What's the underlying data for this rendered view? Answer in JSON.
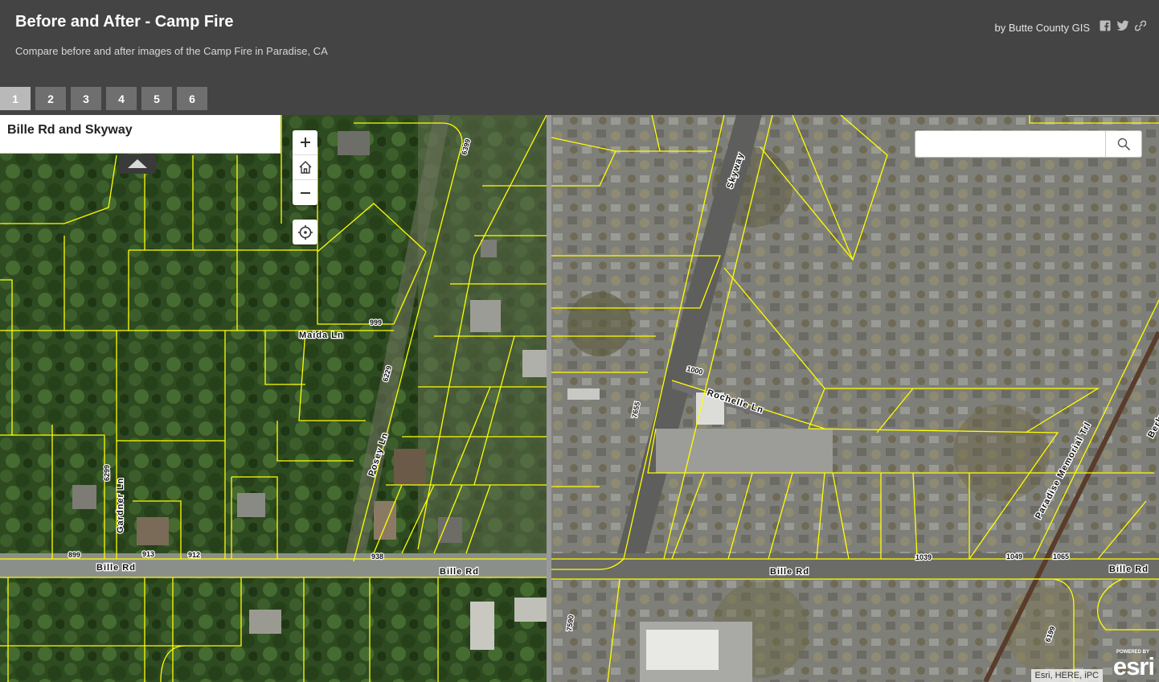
{
  "header": {
    "title": "Before and After - Camp Fire",
    "subtitle": "Compare before and after images of the Camp Fire in Paradise, CA",
    "byline": "by Butte County GIS",
    "share_icons": [
      "facebook-icon",
      "twitter-icon",
      "link-icon"
    ]
  },
  "tabs": [
    {
      "label": "1",
      "active": true
    },
    {
      "label": "2",
      "active": false
    },
    {
      "label": "3",
      "active": false
    },
    {
      "label": "4",
      "active": false
    },
    {
      "label": "5",
      "active": false
    },
    {
      "label": "6",
      "active": false
    }
  ],
  "panel": {
    "title": "Bille Rd and Skyway"
  },
  "map_controls": {
    "zoom_in": "+",
    "zoom_out": "−",
    "icons": [
      "plus-icon",
      "home-icon",
      "minus-icon",
      "locate-icon"
    ]
  },
  "search": {
    "placeholder": "",
    "value": ""
  },
  "map_before": {
    "labels": {
      "maida": "Maida Ln",
      "posey": "Posey Ln",
      "gardner": "Gardner Ln",
      "bille_1": "Bille Rd",
      "bille_2": "Bille Rd",
      "n6399": "6399",
      "n999": "999",
      "n6229": "6229",
      "n6299": "6299",
      "n899": "899",
      "n913": "913",
      "n912": "912",
      "n938": "938"
    }
  },
  "map_after": {
    "labels": {
      "skyway": "Skyway",
      "rochelle": "Rochelle Ln",
      "paradise": "Paradise Memorial Trl",
      "bille_1": "Bille Rd",
      "bille_2": "Bille Rd",
      "berke": "Berke",
      "n1000": "1000",
      "n7655": "7655",
      "n7590": "7590",
      "n1039": "1039",
      "n1049": "1049",
      "n1065": "1065",
      "n6199": "6199"
    }
  },
  "attribution": "Esri, HERE, iPC",
  "esri_logo": {
    "powered": "POWERED BY",
    "word": "esri"
  },
  "colors": {
    "header_bg": "#444444",
    "parcel_line": "#ffff00",
    "tab_active": "#b9b9b9",
    "tab_inactive": "#6f6f6f"
  }
}
